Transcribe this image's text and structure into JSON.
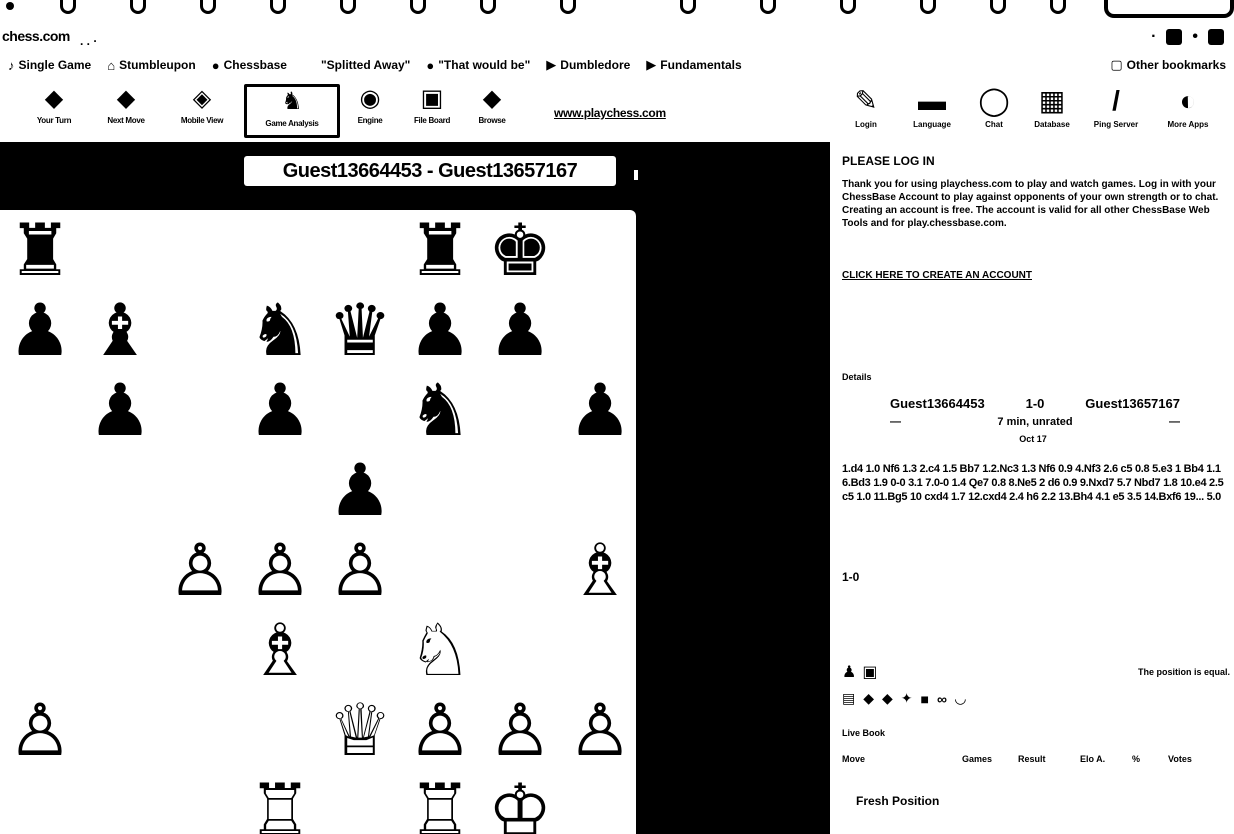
{
  "browser": {
    "url": "chess.com",
    "bookmarks": [
      {
        "icon": "♪",
        "label": "Single Game"
      },
      {
        "icon": "⌂",
        "label": "Stumbleupon"
      },
      {
        "icon": "●",
        "label": "Chessbase"
      },
      {
        "icon": "",
        "label": "\"Splitted Away\""
      },
      {
        "icon": "●",
        "label": "\"That would be\""
      },
      {
        "icon": "▶",
        "label": "Dumbledore"
      },
      {
        "icon": "▶",
        "label": "Fundamentals"
      },
      {
        "icon": "▢",
        "label": "Other bookmarks"
      }
    ]
  },
  "toolbar": {
    "items": [
      {
        "icon": "◆",
        "label": "Your Turn"
      },
      {
        "icon": "◆",
        "label": "Next Move"
      },
      {
        "icon": "◈",
        "label": "Mobile View"
      },
      {
        "icon": "♞",
        "label": "Game Analysis"
      },
      {
        "icon": "◉",
        "label": "Engine"
      },
      {
        "icon": "▣",
        "label": "File Board"
      },
      {
        "icon": "◆",
        "label": "Browse"
      }
    ],
    "site_link": "www.playchess.com",
    "right_items": [
      {
        "icon": "✎",
        "label": "Login"
      },
      {
        "icon": "▬",
        "label": "Language"
      },
      {
        "icon": "◯",
        "label": "Chat"
      },
      {
        "icon": "▦",
        "label": "Database"
      },
      {
        "icon": "/",
        "label": "Ping Server"
      },
      {
        "icon": "◐",
        "label": "More Apps"
      }
    ]
  },
  "game": {
    "header": "Guest13664453 - Guest13657167"
  },
  "panel": {
    "login_title": "PLEASE LOG IN",
    "login_text": "Thank you for using playchess.com to play and watch games. Log in with your ChessBase Account to play against opponents of your own strength or to chat. Creating an account is free. The account is valid for all other ChessBase Web Tools and for play.chessbase.com.",
    "login_link": "CLICK HERE TO CREATE AN ACCOUNT",
    "details_label": "Details",
    "white_player": "Guest13664453",
    "score": "1-0",
    "black_player": "Guest13657167",
    "white_rating": "—",
    "time_control": "7 min, unrated",
    "black_rating": "—",
    "date": "Oct 17",
    "moves": "1.d4 1.0 Nf6 1.3 2.c4 1.5 Bb7 1.2.Nc3 1.3 Nf6 0.9 4.Nf3 2.6 c5 0.8 5.e3 1 Bb4 1.1 6.Bd3 1.9 0-0 3.1 7.0-0 1.4 Qe7 0.8 8.Ne5 2 d6 0.9 9.Nxd7 5.7 Nbd7 1.8 10.e4 2.5 c5 1.0 11.Bg5 10 cxd4 1.7 12.cxd4 2.4 h6 2.2 13.Bh4 4.1 e5 3.5 14.Bxf6 19... 5.0",
    "result": "1-0",
    "equal_text": "The position is equal.",
    "explorer_label": "Live Book",
    "explorer_cols": [
      "Move",
      "Games",
      "Result",
      "Elo A.",
      "%",
      "Votes"
    ],
    "fresh": "Fresh Position"
  },
  "board": [
    {
      "pos": "a8",
      "glyph": "♜"
    },
    {
      "pos": "f8",
      "glyph": "♜"
    },
    {
      "pos": "g8",
      "glyph": "♚"
    },
    {
      "pos": "a7",
      "glyph": "♟"
    },
    {
      "pos": "b7",
      "glyph": "♝"
    },
    {
      "pos": "d7",
      "glyph": "♞"
    },
    {
      "pos": "e7",
      "glyph": "♛"
    },
    {
      "pos": "f7",
      "glyph": "♟"
    },
    {
      "pos": "g7",
      "glyph": "♟"
    },
    {
      "pos": "b6",
      "glyph": "♟"
    },
    {
      "pos": "d6",
      "glyph": "♟"
    },
    {
      "pos": "f6",
      "glyph": "♞"
    },
    {
      "pos": "h6",
      "glyph": "♟"
    },
    {
      "pos": "e5",
      "glyph": "♟"
    },
    {
      "pos": "c4",
      "glyph": "♙"
    },
    {
      "pos": "d4",
      "glyph": "♙"
    },
    {
      "pos": "e4",
      "glyph": "♙"
    },
    {
      "pos": "h4",
      "glyph": "♗"
    },
    {
      "pos": "d3",
      "glyph": "♗"
    },
    {
      "pos": "f3",
      "glyph": "♘"
    },
    {
      "pos": "a2",
      "glyph": "♙"
    },
    {
      "pos": "e2",
      "glyph": "♕"
    },
    {
      "pos": "f2",
      "glyph": "♙"
    },
    {
      "pos": "g2",
      "glyph": "♙"
    },
    {
      "pos": "h2",
      "glyph": "♙"
    },
    {
      "pos": "d1",
      "glyph": "♖"
    },
    {
      "pos": "f1",
      "glyph": "♖"
    },
    {
      "pos": "g1",
      "glyph": "♔"
    }
  ],
  "colors": {
    "background": "#000000",
    "surface": "#ffffff"
  }
}
